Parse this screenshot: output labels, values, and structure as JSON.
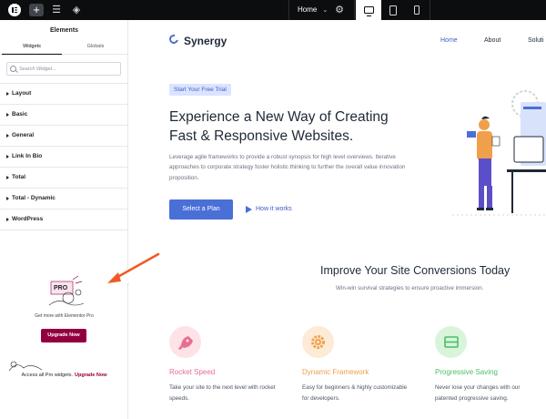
{
  "editor": {
    "topbar": {
      "add_label": "+",
      "page_label": "Home",
      "page_chevron": "⌄",
      "settings_glyph": "⚙",
      "sliders_glyph": "☰",
      "layers_glyph": "◈"
    },
    "panel": {
      "title": "Elements",
      "tabs": [
        {
          "label": "Widgets",
          "active": true
        },
        {
          "label": "Globals",
          "active": false
        }
      ],
      "search": {
        "placeholder": "Search Widget...",
        "value": ""
      },
      "categories": [
        {
          "label": "Layout"
        },
        {
          "label": "Basic"
        },
        {
          "label": "General"
        },
        {
          "label": "Link In Bio"
        },
        {
          "label": "Total"
        },
        {
          "label": "Total - Dynamic"
        },
        {
          "label": "WordPress"
        }
      ],
      "promo": {
        "badge": "PRO",
        "text": "Get more with Elementor Pro",
        "button": "Upgrade Now"
      },
      "pro_access": {
        "text": "Access all Pro widgets.",
        "link": "Upgrade Now"
      },
      "collapse_glyph": "‹"
    }
  },
  "site": {
    "brand": "Synergy",
    "nav": [
      {
        "label": "Home",
        "active": true
      },
      {
        "label": "About",
        "active": false
      },
      {
        "label": "Soluti",
        "active": false
      }
    ],
    "hero": {
      "badge": "Start Your Free Trial",
      "title": "Experience a New Way of Creating Fast & Responsive Websites.",
      "description": "Leverage agile frameworks to provide a robust synopsis for high level overviews. Iterative approaches to corporate strategy foster holistic thinking to further the overall value innovation proposition.",
      "primary_button": "Select a Plan",
      "secondary_link": "How it works"
    },
    "section": {
      "title": "Improve Your Site Conversions Today",
      "subtitle": "Win-win survival strategies to ensure proactive immersion."
    },
    "features": [
      {
        "icon": "rocket-icon",
        "title": "Rocket Speed",
        "description": "Take your site to the next level with rocket speeds.",
        "color": "#e76f8e",
        "bg": "#fde2e8"
      },
      {
        "icon": "gear-icon",
        "title": "Dynamic Framework",
        "description": "Easy for beginners & highly customizable for developers.",
        "color": "#f0a04b",
        "bg": "#fdebd6"
      },
      {
        "icon": "layout-icon",
        "title": "Progressive Saving",
        "description": "Never lose your changes with our patented progressive saving.",
        "color": "#4cbf63",
        "bg": "#d8f5dc"
      }
    ]
  },
  "colors": {
    "topbar_bg": "#0c0d0e",
    "upgrade": "#93003f",
    "accent_blue": "#4a6fd7",
    "annotation_arrow": "#f05a24"
  }
}
